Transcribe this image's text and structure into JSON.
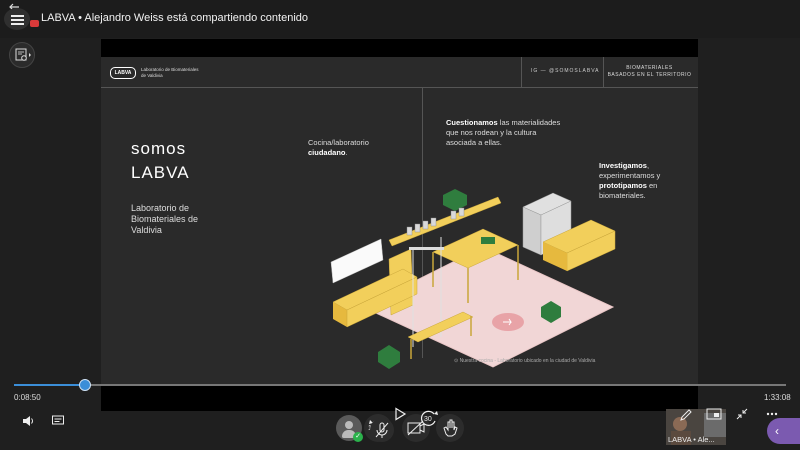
{
  "header": {
    "title": "LABVA • Alejandro Weiss está compartiendo contenido",
    "back_icon": "arrow-left-icon",
    "menu_icon": "hamburger-icon"
  },
  "slide": {
    "logo": "LABVA",
    "logo_text": "Laboratorio de Biomateriales de Valdivia",
    "instagram": "IG — @SOMOSLABVA",
    "header_right_1": "BIOMATERIALES",
    "header_right_2": "BASADOS EN EL TERRITORIO",
    "heading_1": "somos",
    "heading_2": "LABVA",
    "subtitle": "Laboratorio de Biomateriales de Valdivia",
    "cocina_1": "Cocina/laboratorio",
    "cocina_2": "ciudadano",
    "cocina_3": ".",
    "cuestionamos_1": "Cuestionamos",
    "cuestionamos_2": " las materialidades que nos rodean y la cultura asociada a ellas.",
    "inv_1": "Investigamos",
    "inv_2": ", experimentamos y ",
    "inv_3": "prototipamos",
    "inv_4": " en biomateriales.",
    "caption": "Nuestra cocina - Laboratorio ubicado en la ciudad de Valdivia"
  },
  "player": {
    "elapsed": "0:08:50",
    "duration": "1:33:08",
    "progress_fraction": 0.095,
    "rewind_label": "10",
    "forward_label": "30"
  },
  "participant": {
    "label": "LABVA • Ale..."
  },
  "colors": {
    "accent": "#3b8ed8",
    "purple": "#7b5ab0",
    "status_green": "#2bb24c",
    "record_red": "#d93a3a",
    "illustration_yellow": "#f2cf5b",
    "illustration_pink": "#f1d6d6",
    "illustration_green": "#2f7d3e"
  }
}
